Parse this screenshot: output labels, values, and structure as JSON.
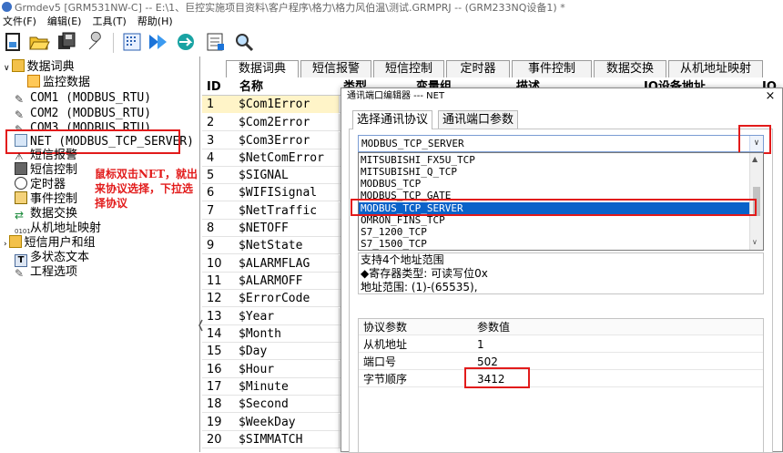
{
  "window": {
    "title": "Grmdev5 [GRM531NW-C]  -- E:\\1、巨控实施项目资料\\客户程序\\格力\\格力风伯温\\测试.GRMPRJ -- (GRM233NQ设备1) *"
  },
  "menu": [
    "文件(F)",
    "编辑(E)",
    "工具(T)",
    "帮助(H)"
  ],
  "toolbar": {
    "icons": [
      "new-icon",
      "open-icon",
      "save-icon",
      "wrench-icon",
      "compile-icon",
      "download-icon",
      "upload-icon",
      "monitor-icon",
      "search-icon"
    ]
  },
  "tree": {
    "items": [
      {
        "label": "数据词典",
        "icon": "folder-icon"
      },
      {
        "label": "监控数据",
        "icon": "data-icon"
      },
      {
        "label": "COM1 (MODBUS_RTU)",
        "icon": "com-icon"
      },
      {
        "label": "COM2 (MODBUS_RTU)",
        "icon": "com-icon"
      },
      {
        "label": "COM3 (MODBUS_RTU)",
        "icon": "com-icon"
      },
      {
        "label": "NET (MODBUS_TCP_SERVER)",
        "icon": "net-icon"
      },
      {
        "label": "短信报警",
        "icon": "bell-icon"
      },
      {
        "label": "短信控制",
        "icon": "sms-icon"
      },
      {
        "label": "定时器",
        "icon": "clock-icon"
      },
      {
        "label": "事件控制",
        "icon": "event-icon"
      },
      {
        "label": "数据交换",
        "icon": "exchange-icon"
      },
      {
        "label": "从机地址映射",
        "icon": "map-icon"
      },
      {
        "label": "短信用户和组",
        "icon": "users-icon"
      },
      {
        "label": "多状态文本",
        "icon": "text-icon"
      },
      {
        "label": "工程选项",
        "icon": "options-icon"
      }
    ],
    "annotation": [
      "鼠标双击NET，就出",
      "来协议选择，下拉选",
      "择协议"
    ]
  },
  "tabs": [
    "数据词典",
    "短信报警",
    "短信控制",
    "定时器",
    "事件控制",
    "数据交换",
    "从机地址映射"
  ],
  "grid": {
    "headers": [
      "ID",
      "名称",
      "类型",
      "变量组",
      "描述",
      "IO设备地址",
      "IO"
    ],
    "rows": [
      {
        "id": "1",
        "name": "$Com1Error"
      },
      {
        "id": "2",
        "name": "$Com2Error"
      },
      {
        "id": "3",
        "name": "$Com3Error"
      },
      {
        "id": "4",
        "name": "$NetComError"
      },
      {
        "id": "5",
        "name": "$SIGNAL"
      },
      {
        "id": "6",
        "name": "$WIFISignal"
      },
      {
        "id": "7",
        "name": "$NetTraffic"
      },
      {
        "id": "8",
        "name": "$NETOFF"
      },
      {
        "id": "9",
        "name": "$NetState"
      },
      {
        "id": "10",
        "name": "$ALARMFLAG"
      },
      {
        "id": "11",
        "name": "$ALARMOFF"
      },
      {
        "id": "12",
        "name": "$ErrorCode"
      },
      {
        "id": "13",
        "name": "$Year"
      },
      {
        "id": "14",
        "name": "$Month"
      },
      {
        "id": "15",
        "name": "$Day"
      },
      {
        "id": "16",
        "name": "$Hour"
      },
      {
        "id": "17",
        "name": "$Minute"
      },
      {
        "id": "18",
        "name": "$Second"
      },
      {
        "id": "19",
        "name": "$WeekDay"
      },
      {
        "id": "20",
        "name": "$SIMMATCH"
      }
    ]
  },
  "dialog": {
    "title": "通讯端口编辑器 --- NET",
    "close": "×",
    "tabs": [
      "选择通讯协议",
      "通讯端口参数"
    ],
    "selected_protocol": "MODBUS_TCP_SERVER",
    "options": [
      "MITSUBISHI_FX5U_TCP",
      "MITSUBISHI_Q_TCP",
      "MODBUS_TCP",
      "MODBUS_TCP_GATE",
      "MODBUS_TCP_SERVER",
      "OMRON_FINS_TCP",
      "S7_1200_TCP",
      "S7_1500_TCP"
    ],
    "selected_index": 4,
    "description": [
      "支持4个地址范围",
      "◆寄存器类型: 可读写位0x",
      "地址范围: (1)-(65535),"
    ],
    "param_headers": [
      "协议参数",
      "参数值"
    ],
    "params": [
      {
        "key": "从机地址",
        "value": "1"
      },
      {
        "key": "端口号",
        "value": "502"
      },
      {
        "key": "字节顺序",
        "value": "3412"
      }
    ]
  },
  "colors": {
    "highlight_red": "#e21b1b",
    "selection_blue": "#0a62c9",
    "selected_row": "#fff4c8"
  }
}
